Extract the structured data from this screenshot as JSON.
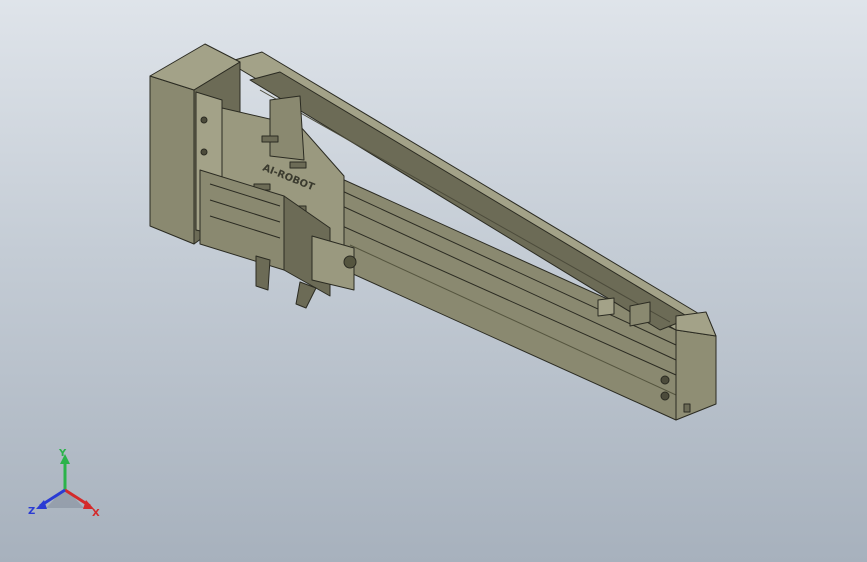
{
  "viewport": {
    "background_top": "#dfe4ea",
    "background_bottom": "#a7b1bd"
  },
  "model": {
    "body_color": "#8a8970",
    "body_dark": "#6c6b56",
    "body_light": "#a3a288",
    "edge_color": "#2b2b22",
    "logo_text": "AI-ROBOT"
  },
  "triad": {
    "x_label": "X",
    "y_label": "Y",
    "z_label": "Z",
    "x_color": "#d42a2a",
    "y_color": "#2bb34a",
    "z_color": "#2a3bd4"
  }
}
